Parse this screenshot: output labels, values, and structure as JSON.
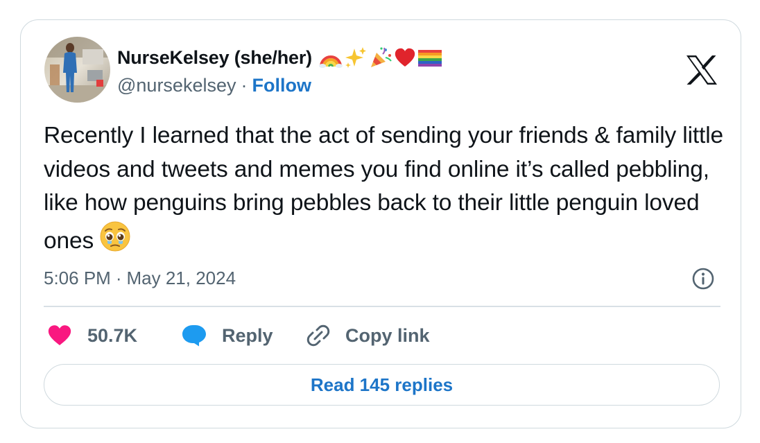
{
  "author": {
    "display_name": "NurseKelsey (she/her)",
    "name_emojis": [
      "rainbow-emoji",
      "sparkles-emoji",
      "party-popper-emoji",
      "red-heart-emoji",
      "rainbow-flag-emoji"
    ],
    "handle": "@nursekelsey",
    "separator": "·",
    "follow_label": "Follow"
  },
  "tweet": {
    "text": "Recently I learned that the act of sending your friends & family little videos and tweets and memes you find online it’s called pebbling, like how penguins bring pebbles back to their little penguin loved ones",
    "trailing_emoji": "pleading-face-emoji",
    "time": "5:06 PM",
    "separator": "·",
    "date": "May 21, 2024"
  },
  "actions": {
    "likes_count": "50.7K",
    "reply_label": "Reply",
    "copy_link_label": "Copy link"
  },
  "read_replies_label": "Read 145 replies",
  "icons": {
    "brand": "x-logo-icon",
    "info": "info-icon",
    "like": "heart-icon",
    "reply": "speech-bubble-icon",
    "copy": "link-icon"
  },
  "colors": {
    "text": "#0f1419",
    "secondary_text": "#536471",
    "link": "#1d75c8",
    "like": "#f91880",
    "reply": "#1d9bf0",
    "border": "#cfd9de"
  }
}
